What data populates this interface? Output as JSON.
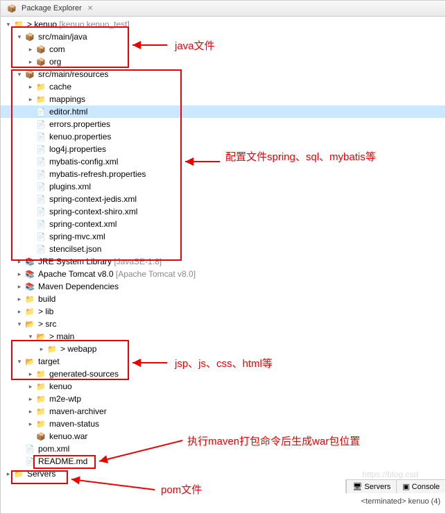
{
  "panel": {
    "title": "Package Explorer"
  },
  "root": {
    "label": "kenuo",
    "deco": "[kenuo kenuo_test]",
    "children": {
      "src_java": {
        "label": "src/main/java",
        "children": [
          "com",
          "org"
        ]
      },
      "src_res": {
        "label": "src/main/resources",
        "children": [
          "cache",
          "mappings",
          "editor.html",
          "errors.properties",
          "kenuo.properties",
          "log4j.properties",
          "mybatis-config.xml",
          "mybatis-refresh.properties",
          "plugins.xml",
          "spring-context-jedis.xml",
          "spring-context-shiro.xml",
          "spring-context.xml",
          "spring-mvc.xml",
          "stencilset.json"
        ]
      },
      "jre": {
        "label": "JRE System Library",
        "deco": "[JavaSE-1.8]"
      },
      "tomcat": {
        "label": "Apache Tomcat v8.0",
        "deco": "[Apache Tomcat v8.0]"
      },
      "maven_deps": {
        "label": "Maven Dependencies"
      },
      "build": {
        "label": "build"
      },
      "lib": {
        "label": "> lib"
      },
      "src": {
        "label": "> src",
        "main": {
          "label": "> main",
          "webapp": "> webapp"
        }
      },
      "target": {
        "label": "target",
        "children": [
          "generated-sources",
          "kenuo",
          "m2e-wtp",
          "maven-archiver",
          "maven-status",
          "kenuo.war"
        ]
      },
      "pom": {
        "label": "pom.xml"
      },
      "readme": {
        "label": "README.md"
      },
      "servers": {
        "label": "Servers"
      }
    }
  },
  "annotations": {
    "java": "java文件",
    "config": "配置文件spring、sql、mybatis等",
    "jsp": "jsp、js、css、html等",
    "war": "执行maven打包命令后生成war包位置",
    "pom": "pom文件"
  },
  "bottom": {
    "tabs": [
      "Servers",
      "Console"
    ],
    "status_prefix": "<terminated>",
    "status_name": "kenuo (4)"
  },
  "watermark": "https://blog.csd"
}
